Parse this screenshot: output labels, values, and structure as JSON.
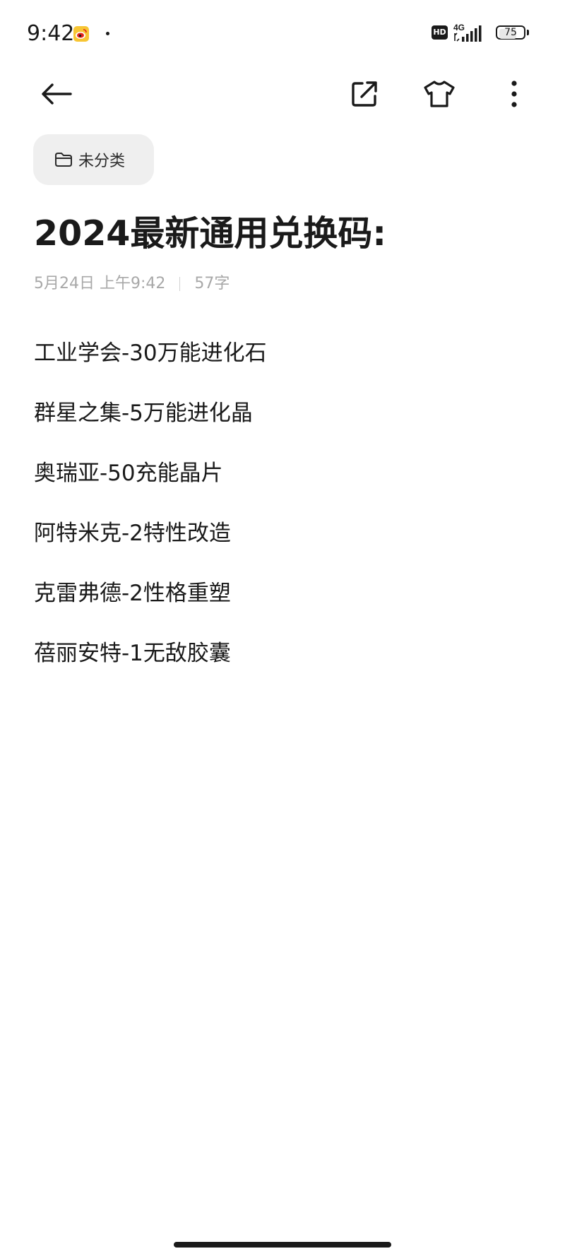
{
  "status_bar": {
    "time": "9:42",
    "network": "4G",
    "hd_label": "HD",
    "battery_level": "75",
    "battery_fraction": 0.75,
    "notification_icon": "weibo-icon"
  },
  "toolbar": {
    "back_icon": "arrow-left-icon",
    "share_icon": "share-external-icon",
    "theme_icon": "tshirt-icon",
    "more_icon": "more-vertical-icon"
  },
  "folder": {
    "label": "未分类",
    "icon": "folder-icon"
  },
  "note": {
    "title": "2024最新通用兑换码:",
    "date": "5月24日 上午9:42",
    "word_count": "57字",
    "lines": [
      "工业学会-30万能进化石",
      "群星之集-5万能进化晶",
      "奥瑞亚-50充能晶片",
      "阿特米克-2特性改造",
      "克雷弗德-2性格重塑",
      "蓓丽安特-1无敌胶囊"
    ]
  },
  "colors": {
    "background": "#ffffff",
    "text_primary": "#1a1a1a",
    "text_meta": "#a8a8a8",
    "chip_background": "#efefef"
  }
}
